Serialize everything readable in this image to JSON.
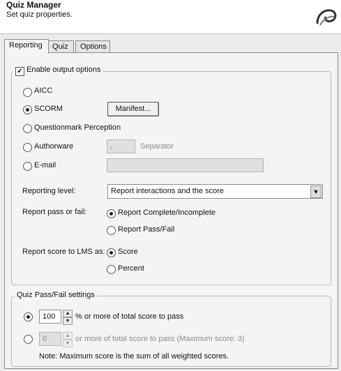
{
  "header": {
    "title": "Quiz Manager",
    "subtitle": "Set quiz properties."
  },
  "tabs": [
    {
      "label": "Reporting",
      "active": true
    },
    {
      "label": "Quiz",
      "active": false
    },
    {
      "label": "Options",
      "active": false
    }
  ],
  "reporting": {
    "enable_label": "Enable output options",
    "enable_checked": true,
    "aicc_label": "AICC",
    "scorm_label": "SCORM",
    "manifest_button": "Manifest...",
    "questionmark_label": "Questionmark Perception",
    "authorware_label": "Authorware",
    "separator_value": ",",
    "separator_label": "Separator",
    "email_label": "E-mail",
    "email_value": "",
    "selected_output": "SCORM",
    "reporting_level_label": "Reporting level:",
    "reporting_level_value": "Report interactions and the score",
    "pass_fail_label": "Report pass or fail:",
    "pass_fail_option1": "Report Complete/Incomplete",
    "pass_fail_option2": "Report Pass/Fail",
    "pass_fail_selected": "Report Complete/Incomplete",
    "score_label": "Report score to LMS as:",
    "score_option1": "Score",
    "score_option2": "Percent",
    "score_selected": "Score"
  },
  "pass_fail_settings": {
    "legend": "Quiz Pass/Fail settings",
    "percent_value": "100",
    "percent_label": "% or more of total score to pass",
    "points_value": "0",
    "points_label": "or more of total score to pass (Maximum score: 3)",
    "note": "Note: Maximum score is the sum of all weighted scores.",
    "selected": "percent"
  },
  "icons": {
    "logo": "captivate-logo-icon",
    "dropdown": "chevron-down-icon"
  }
}
